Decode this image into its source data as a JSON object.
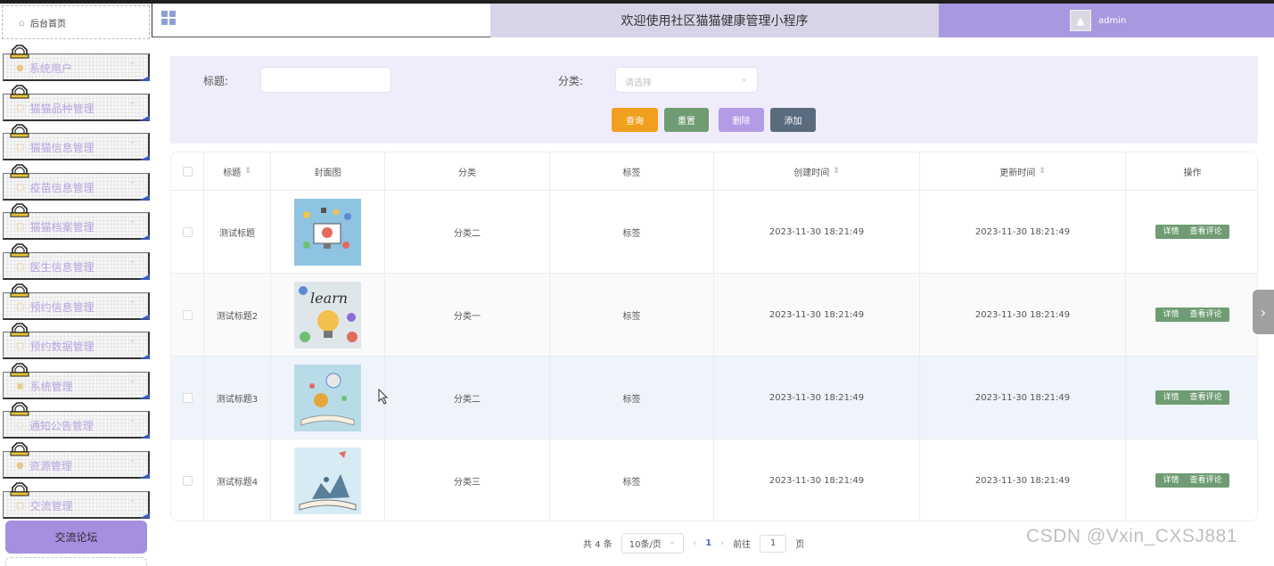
{
  "sidebar": {
    "home_label": "后台首页",
    "items": [
      {
        "label": "系统用户",
        "icon": "user-icon"
      },
      {
        "label": "猫猫品种管理",
        "icon": "document-icon"
      },
      {
        "label": "猫猫信息管理",
        "icon": "document-icon"
      },
      {
        "label": "疫苗信息管理",
        "icon": "document-icon"
      },
      {
        "label": "猫猫档案管理",
        "icon": "document-icon"
      },
      {
        "label": "医生信息管理",
        "icon": "document-icon"
      },
      {
        "label": "预约信息管理",
        "icon": "document-icon"
      },
      {
        "label": "预约数据管理",
        "icon": "document-icon"
      },
      {
        "label": "系统管理",
        "icon": "settings-icon"
      },
      {
        "label": "通知公告管理",
        "icon": "info-icon"
      },
      {
        "label": "资源管理",
        "icon": "location-icon"
      },
      {
        "label": "交流管理",
        "icon": "chat-icon"
      }
    ],
    "forum_button": "交流论坛"
  },
  "header": {
    "title": "欢迎使用社区猫猫健康管理小程序",
    "user": "admin"
  },
  "search": {
    "title_label": "标题:",
    "title_value": "",
    "category_label": "分类:",
    "category_placeholder": "请选择",
    "buttons": {
      "query": "查询",
      "reset": "重置",
      "delete": "删除",
      "add": "添加"
    },
    "colors": {
      "query": "#f0a01e",
      "reset": "#6f9c72",
      "delete": "#b39be6",
      "add": "#5a6b7d"
    }
  },
  "table": {
    "columns": [
      "标题",
      "封面图",
      "分类",
      "标签",
      "创建时间",
      "更新时间",
      "操作"
    ],
    "rows": [
      {
        "title": "测试标题",
        "category": "分类二",
        "tag": "标签",
        "created": "2023-11-30 18:21:49",
        "updated": "2023-11-30 18:21:49"
      },
      {
        "title": "测试标题2",
        "category": "分类一",
        "tag": "标签",
        "created": "2023-11-30 18:21:49",
        "updated": "2023-11-30 18:21:49"
      },
      {
        "title": "测试标题3",
        "category": "分类二",
        "tag": "标签",
        "created": "2023-11-30 18:21:49",
        "updated": "2023-11-30 18:21:49"
      },
      {
        "title": "测试标题4",
        "category": "分类三",
        "tag": "标签",
        "created": "2023-11-30 18:21:49",
        "updated": "2023-11-30 18:21:49"
      }
    ],
    "actions": {
      "detail": "详情",
      "comments": "查看评论"
    }
  },
  "pagination": {
    "total": "共 4 条",
    "page_size": "10条/页",
    "current_page": "1",
    "goto_label": "前往",
    "goto_value": "1",
    "page_suffix": "页"
  },
  "watermark": "CSDN @Vxin_CXSJ881"
}
